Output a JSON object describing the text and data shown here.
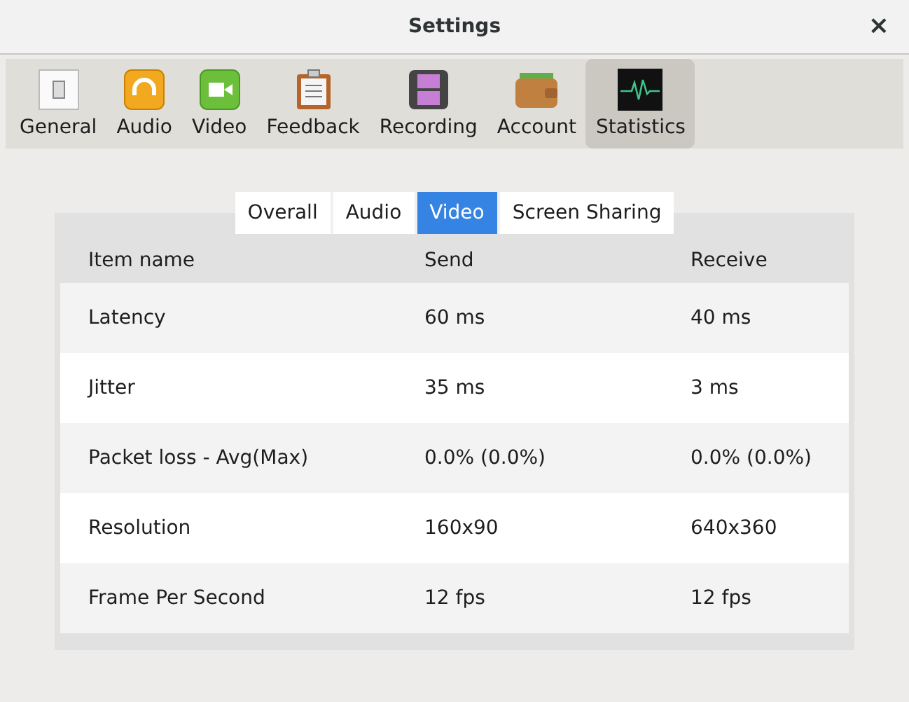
{
  "window": {
    "title": "Settings",
    "close": "×"
  },
  "toolbar": [
    {
      "label": "General",
      "kind": "general",
      "selected": false
    },
    {
      "label": "Audio",
      "kind": "audio",
      "selected": false
    },
    {
      "label": "Video",
      "kind": "video",
      "selected": false
    },
    {
      "label": "Feedback",
      "kind": "feedback",
      "selected": false
    },
    {
      "label": "Recording",
      "kind": "recording",
      "selected": false
    },
    {
      "label": "Account",
      "kind": "account",
      "selected": false
    },
    {
      "label": "Statistics",
      "kind": "statistics",
      "selected": true
    }
  ],
  "tabs": [
    {
      "label": "Overall",
      "selected": false
    },
    {
      "label": "Audio",
      "selected": false
    },
    {
      "label": "Video",
      "selected": true
    },
    {
      "label": "Screen Sharing",
      "selected": false
    }
  ],
  "table": {
    "columns": [
      "Item name",
      "Send",
      "Receive"
    ],
    "rows": [
      [
        "Latency",
        "60 ms",
        "40 ms"
      ],
      [
        "Jitter",
        "35 ms",
        "3 ms"
      ],
      [
        "Packet loss - Avg(Max)",
        "0.0% (0.0%)",
        "0.0% (0.0%)"
      ],
      [
        "Resolution",
        "160x90",
        "640x360"
      ],
      [
        "Frame Per Second",
        "12 fps",
        "12 fps"
      ]
    ]
  }
}
